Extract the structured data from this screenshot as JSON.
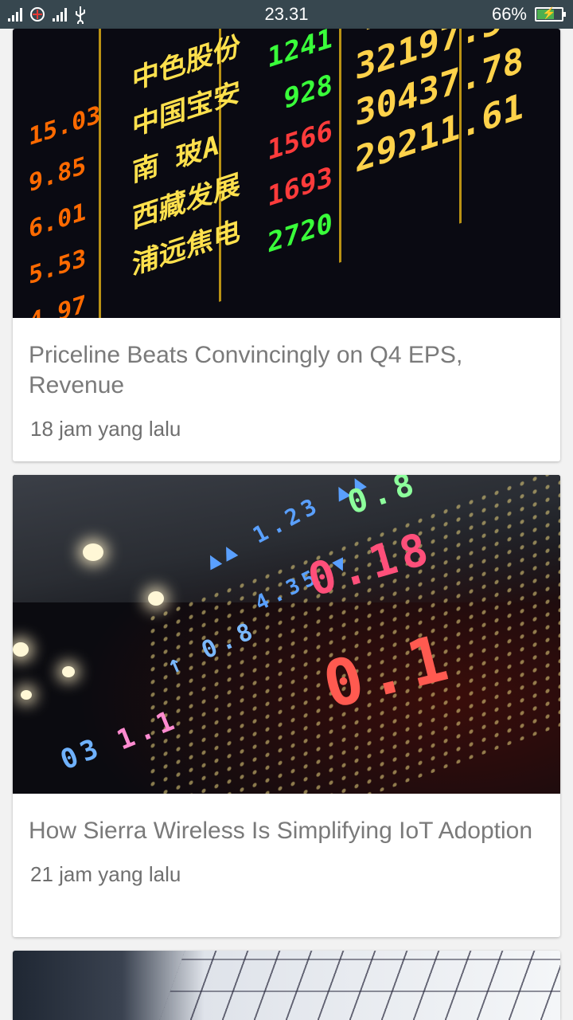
{
  "status_bar": {
    "time": "23.31",
    "battery": "66%",
    "battery_level": 0.66
  },
  "articles": [
    {
      "title": "Priceline Beats Convincingly on Q4 EPS, Revenue",
      "time_ago": "18 jam yang lalu"
    },
    {
      "title": "How Sierra Wireless Is Simplifying IoT Adoption",
      "time_ago": "21 jam yang lalu"
    }
  ],
  "colors": {
    "status_bar": "#37474f",
    "background": "#f2f2f2",
    "title_text": "#7a7a7a",
    "time_text": "#6f6f6f",
    "battery_fill": "#4caf50"
  }
}
